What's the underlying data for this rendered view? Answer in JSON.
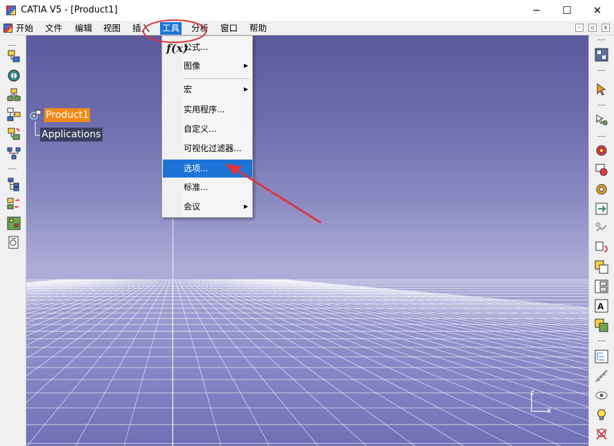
{
  "window": {
    "title": "CATIA V5 - [Product1]",
    "controls": {
      "minimize": "─",
      "maximize": "☐",
      "close": "✕"
    }
  },
  "menubar": {
    "items": [
      "开始",
      "文件",
      "编辑",
      "视图",
      "插入",
      "工具",
      "分析",
      "窗口",
      "帮助"
    ],
    "active": "工具",
    "mdi_controls": [
      "-",
      "▫",
      "x"
    ]
  },
  "tools_menu": {
    "items": [
      {
        "label": "公式...",
        "icon": "fx-icon",
        "submenu": false
      },
      {
        "label": "图像",
        "submenu": true
      },
      {
        "label": "宏",
        "submenu": true
      },
      {
        "label": "实用程序...",
        "submenu": false
      },
      {
        "label": "自定义...",
        "submenu": false
      },
      {
        "label": "可视化过滤器...",
        "submenu": false
      },
      {
        "label": "选项...",
        "submenu": false,
        "highlighted": true
      },
      {
        "label": "标准...",
        "submenu": false
      },
      {
        "label": "会议",
        "submenu": true
      }
    ],
    "arrow_glyph": "▶"
  },
  "tree": {
    "root": "Product1",
    "child": "Applications"
  },
  "compass": {
    "z_label": "z",
    "x_label": "x"
  },
  "colors": {
    "menu_highlight": "#1e74d6",
    "tree_root_bg": "#f08a14",
    "annotation_red": "#e0343c"
  }
}
